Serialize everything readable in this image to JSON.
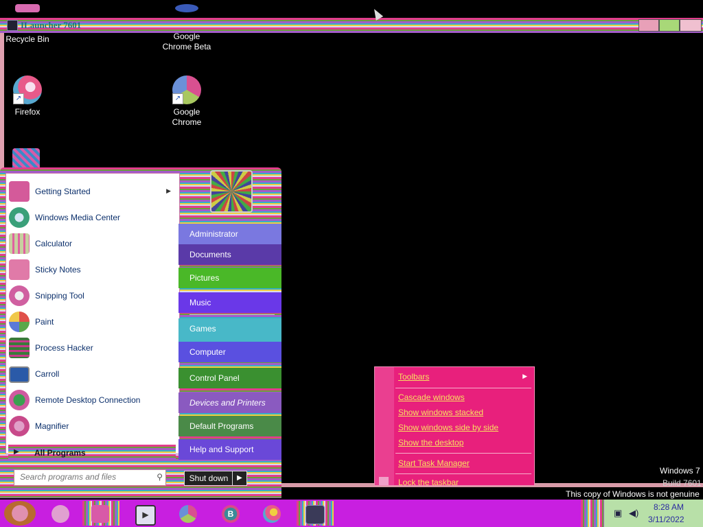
{
  "desktop": {
    "icons": [
      {
        "label": "Recycle Bin"
      },
      {
        "label": "Google Chrome Beta"
      },
      {
        "label": "Firefox"
      },
      {
        "label": "Google Chrome"
      }
    ],
    "watermark": {
      "os": "Windows 7",
      "build": "Build 7601",
      "notice": "This copy of Windows is not genuine"
    }
  },
  "launcher_window": {
    "title": "ILauncher 7601"
  },
  "start_menu": {
    "pinned": [
      {
        "label": "Getting Started",
        "has_submenu": true,
        "icon": "getting-started-icon",
        "color": "#d45a9a"
      },
      {
        "label": "Windows Media Center",
        "has_submenu": false,
        "icon": "media-center-icon",
        "color": "#3aa07a"
      },
      {
        "label": "Calculator",
        "has_submenu": false,
        "icon": "calculator-icon",
        "color": "#c8d0a0"
      },
      {
        "label": "Sticky Notes",
        "has_submenu": false,
        "icon": "sticky-notes-icon",
        "color": "#e07aa8"
      },
      {
        "label": "Snipping Tool",
        "has_submenu": false,
        "icon": "snipping-tool-icon",
        "color": "#d060a0"
      },
      {
        "label": "Paint",
        "has_submenu": false,
        "icon": "paint-icon",
        "color": "#e0504a"
      },
      {
        "label": "Process Hacker",
        "has_submenu": false,
        "icon": "process-hacker-icon",
        "color": "#3a7a3a"
      },
      {
        "label": "Carroll",
        "has_submenu": false,
        "icon": "monitor-icon",
        "color": "#2a5aa8"
      },
      {
        "label": "Remote Desktop Connection",
        "has_submenu": false,
        "icon": "remote-desktop-icon",
        "color": "#3aa050"
      },
      {
        "label": "Magnifier",
        "has_submenu": false,
        "icon": "magnifier-icon",
        "color": "#c84a8a"
      }
    ],
    "all_programs": "All Programs",
    "search_placeholder": "Search programs and files",
    "right_items": [
      {
        "label": "Administrator"
      },
      {
        "label": "Documents"
      },
      {
        "label": "Pictures"
      },
      {
        "label": "Music"
      },
      {
        "label": "Games"
      },
      {
        "label": "Computer"
      },
      {
        "label": "Control Panel"
      },
      {
        "label": "Devices and Printers"
      },
      {
        "label": "Default Programs"
      },
      {
        "label": "Help and Support"
      }
    ],
    "shutdown": "Shut down"
  },
  "context_menu": {
    "items": [
      {
        "label": "Toolbars",
        "submenu": true
      },
      {
        "label": "Cascade windows"
      },
      {
        "label": "Show windows stacked"
      },
      {
        "label": "Show windows side by side"
      },
      {
        "label": "Show the desktop"
      },
      {
        "label": "Start Task Manager"
      },
      {
        "label": "Lock the taskbar"
      }
    ]
  },
  "taskbar": {
    "buttons": [
      {
        "icon": "start-orb-icon"
      },
      {
        "icon": "app-icon-1"
      },
      {
        "icon": "app-icon-2"
      },
      {
        "icon": "media-player-icon"
      },
      {
        "icon": "chrome-icon"
      },
      {
        "icon": "edge-beta-icon"
      },
      {
        "icon": "firefox-icon"
      },
      {
        "icon": "launcher-icon"
      }
    ],
    "clock": {
      "time": "8:28 AM",
      "date": "3/11/2022"
    }
  }
}
